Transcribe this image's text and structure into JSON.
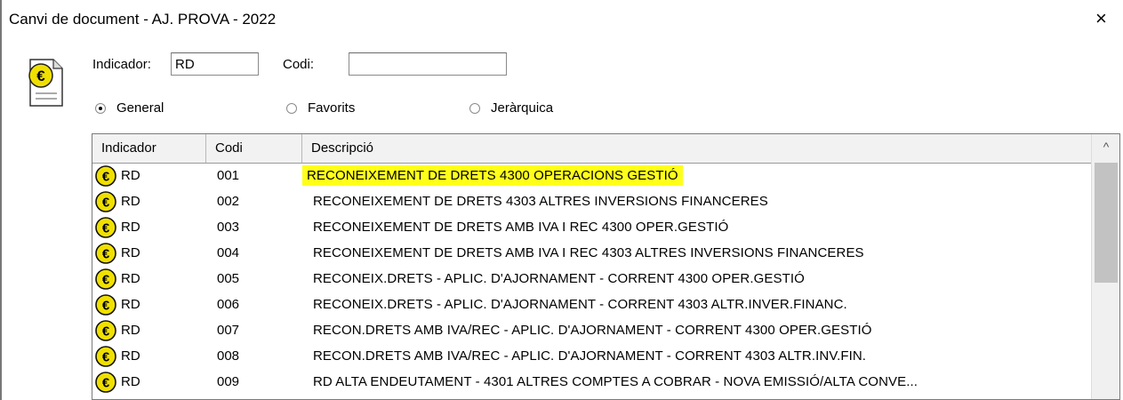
{
  "window": {
    "title": "Canvi de document - AJ. PROVA - 2022",
    "close_symbol": "×"
  },
  "form": {
    "indicador_label": "Indicador:",
    "indicador_value": "RD",
    "codi_label": "Codi:",
    "codi_value": "",
    "radios": [
      {
        "label": "General",
        "selected": true
      },
      {
        "label": "Favorits",
        "selected": false
      },
      {
        "label": "Jeràrquica",
        "selected": false
      }
    ]
  },
  "table": {
    "columns": [
      "Indicador",
      "Codi",
      "Descripció"
    ],
    "rows": [
      {
        "indicador": "RD",
        "codi": "001",
        "descripcio": "RECONEIXEMENT DE DRETS 4300 OPERACIONS GESTIÓ",
        "highlighted": true
      },
      {
        "indicador": "RD",
        "codi": "002",
        "descripcio": "RECONEIXEMENT DE DRETS 4303 ALTRES INVERSIONS FINANCERES"
      },
      {
        "indicador": "RD",
        "codi": "003",
        "descripcio": "RECONEIXEMENT DE DRETS AMB IVA I REC 4300 OPER.GESTIÓ"
      },
      {
        "indicador": "RD",
        "codi": "004",
        "descripcio": "RECONEIXEMENT DE DRETS AMB IVA I REC 4303 ALTRES INVERSIONS FINANCERES"
      },
      {
        "indicador": "RD",
        "codi": "005",
        "descripcio": "RECONEIX.DRETS - APLIC. D'AJORNAMENT - CORRENT 4300 OPER.GESTIÓ"
      },
      {
        "indicador": "RD",
        "codi": "006",
        "descripcio": "RECONEIX.DRETS - APLIC. D'AJORNAMENT - CORRENT 4303 ALTR.INVER.FINANC."
      },
      {
        "indicador": "RD",
        "codi": "007",
        "descripcio": "RECON.DRETS AMB IVA/REC - APLIC. D'AJORNAMENT - CORRENT 4300 OPER.GESTIÓ"
      },
      {
        "indicador": "RD",
        "codi": "008",
        "descripcio": "RECON.DRETS AMB IVA/REC - APLIC. D'AJORNAMENT - CORRENT 4303 ALTR.INV.FIN."
      },
      {
        "indicador": "RD",
        "codi": "009",
        "descripcio": "RD ALTA ENDEUTAMENT - 4301 ALTRES COMPTES A COBRAR - NOVA EMISSIÓ/ALTA CONVE..."
      }
    ]
  },
  "colors": {
    "highlight": "#ffff1a",
    "euro_icon": "#f0e000"
  },
  "icons": {
    "document": "euro-document-icon",
    "row": "euro-icon",
    "scroll_up": "chevron-up-icon"
  }
}
